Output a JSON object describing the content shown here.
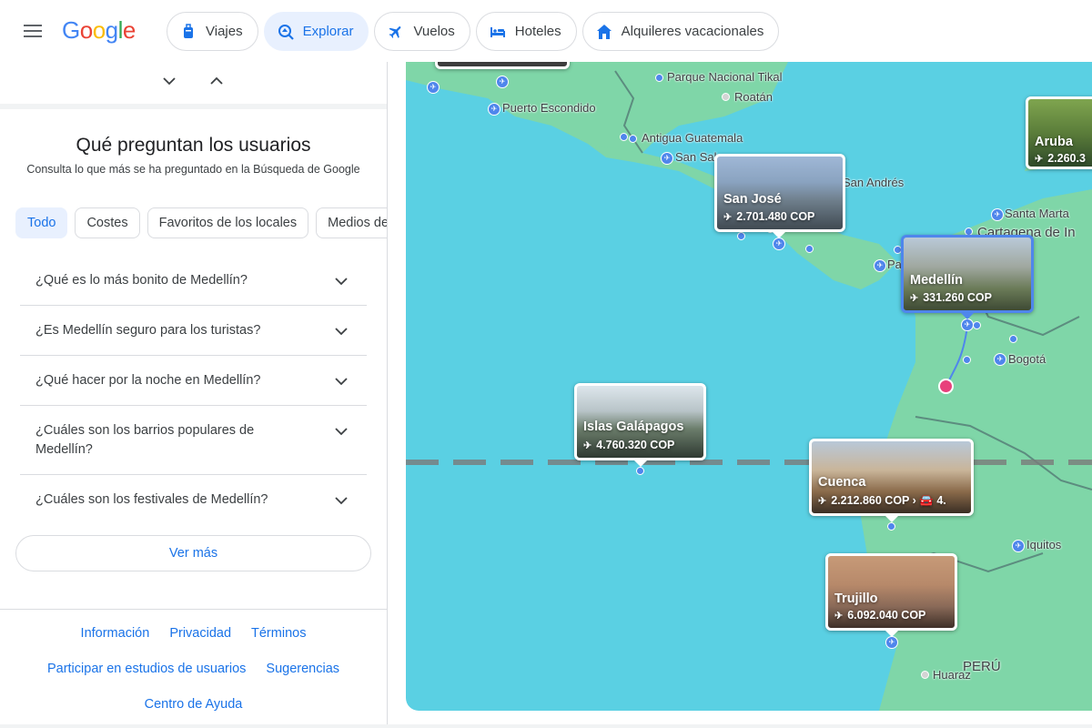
{
  "header": {
    "logo": [
      "G",
      "o",
      "o",
      "g",
      "l",
      "e"
    ],
    "tabs": [
      {
        "label": "Viajes",
        "icon": "luggage-icon"
      },
      {
        "label": "Explorar",
        "icon": "explore-icon",
        "active": true
      },
      {
        "label": "Vuelos",
        "icon": "plane-icon"
      },
      {
        "label": "Hoteles",
        "icon": "bed-icon"
      },
      {
        "label": "Alquileres vacacionales",
        "icon": "house-icon"
      }
    ]
  },
  "panel": {
    "title": "Qué preguntan los usuarios",
    "subtitle": "Consulta lo que más se ha preguntado en la Búsqueda de Google",
    "chips": [
      "Todo",
      "Costes",
      "Favoritos de los locales",
      "Medios de transporte"
    ],
    "questions": [
      "¿Qué es lo más bonito de Medellín?",
      "¿Es Medellín seguro para los turistas?",
      "¿Qué hacer por la noche en Medellín?",
      "¿Cuáles son los barrios populares de Medellín?",
      "¿Cuáles son los festivales de Medellín?"
    ],
    "more_button": "Ver más"
  },
  "footer": {
    "row1": [
      "Información",
      "Privacidad",
      "Términos"
    ],
    "row2": [
      "Participar en estudios de usuarios",
      "Sugerencias"
    ],
    "row3": [
      "Centro de Ayuda"
    ]
  },
  "map": {
    "labels": {
      "tikal": "Parque Nacional Tikal",
      "roatan": "Roatán",
      "puerto": "Puerto Escondido",
      "antigua": "Antigua Guatemala",
      "sansal": "San Sal",
      "sanandres": "San Andrés",
      "santamarta": "Santa Marta",
      "cartagena": "Cartagena de In",
      "pa": "Pa",
      "bogota": "Bogotá",
      "iquitos": "Iquitos",
      "peru": "PERÚ",
      "huaraz": "Huaraz"
    },
    "cards": {
      "aruba": {
        "name": "Aruba",
        "price": "2.260.3"
      },
      "sanjose": {
        "name": "San José",
        "price": "2.701.480 COP"
      },
      "medellin": {
        "name": "Medellín",
        "price": "331.260 COP"
      },
      "galapagos": {
        "name": "Islas Galápagos",
        "price": "4.760.320 COP"
      },
      "cuenca": {
        "name": "Cuenca",
        "price": "2.212.860 COP",
        "extra": "4."
      },
      "trujillo": {
        "name": "Trujillo",
        "price": "6.092.040 COP"
      }
    }
  }
}
